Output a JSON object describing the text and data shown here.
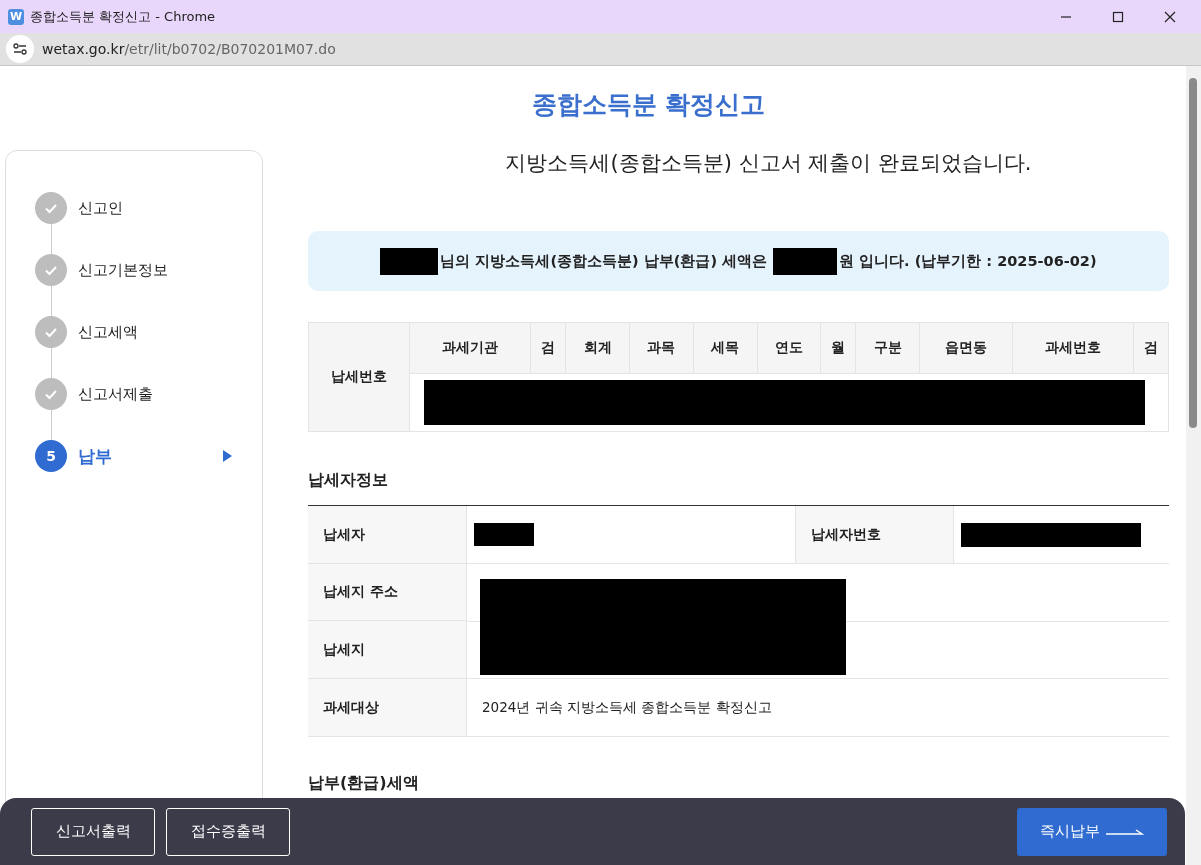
{
  "window": {
    "title": "종합소득분 확정신고 - Chrome",
    "app_letter": "W"
  },
  "address_bar": {
    "domain": "wetax.go.kr",
    "path": "/etr/lit/b0702/B070201M07.do"
  },
  "steps": [
    {
      "label": "신고인",
      "kind": "done",
      "selected": false
    },
    {
      "label": "신고기본정보",
      "kind": "done",
      "selected": false
    },
    {
      "label": "신고세액",
      "kind": "done",
      "selected": false
    },
    {
      "label": "신고서제출",
      "kind": "done",
      "selected": false
    },
    {
      "label": "납부",
      "kind": "current",
      "number": "5",
      "selected": true
    }
  ],
  "page_title": "종합소득분 확정신고",
  "completion_message": "지방소득세(종합소득분) 신고서 제출이 완료되었습니다.",
  "notice": {
    "text_1": "님의 지방소득세(종합소득분) 납부(환급) 세액은",
    "text_2": "원 입니다. (납부기한 : 2025-06-02)"
  },
  "tax_number_table": {
    "row_header": "납세번호",
    "columns": [
      "과세기관",
      "검",
      "회계",
      "과목",
      "세목",
      "연도",
      "월",
      "구분",
      "읍면동",
      "과세번호",
      "검"
    ]
  },
  "taxpayer_section": {
    "heading": "납세자정보",
    "rows": [
      {
        "label": "납세자",
        "label_2": "납세자번호"
      },
      {
        "label": "납세지 주소"
      },
      {
        "label": "납세지"
      },
      {
        "label": "과세대상",
        "value": "2024년 귀속 지방소득세 종합소득분 확정신고"
      }
    ]
  },
  "next_section_heading": "납부(환급)세액",
  "footer": {
    "left_buttons": [
      "신고서출력",
      "접수증출력"
    ],
    "primary_button": "즉시납부"
  }
}
